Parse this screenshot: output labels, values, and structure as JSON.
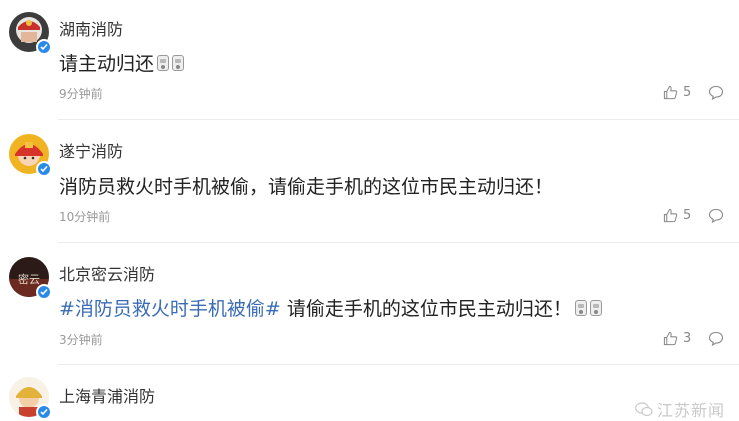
{
  "comments": [
    {
      "name": "湖南消防",
      "content": "请主动归还",
      "time": "9分钟前",
      "likes": "5"
    },
    {
      "name": "遂宁消防",
      "content": "消防员救火时手机被偷，请偷走手机的这位市民主动归还！",
      "time": "10分钟前",
      "likes": "5"
    },
    {
      "name": "北京密云消防",
      "hashtag": "#消防员救火时手机被偷#",
      "content": " 请偷走手机的这位市民主动归还！",
      "time": "3分钟前",
      "likes": "3"
    },
    {
      "name": "上海青浦消防"
    }
  ],
  "watermark": {
    "text": "江苏新闻"
  },
  "icons": [
    "verified-badge-icon",
    "thumbs-up-icon",
    "comment-bubble-icon",
    "emoji-icon"
  ],
  "colors": {
    "hashtag": "#3a6db5",
    "verified": "#2a8ae8",
    "meta": "#999999"
  }
}
